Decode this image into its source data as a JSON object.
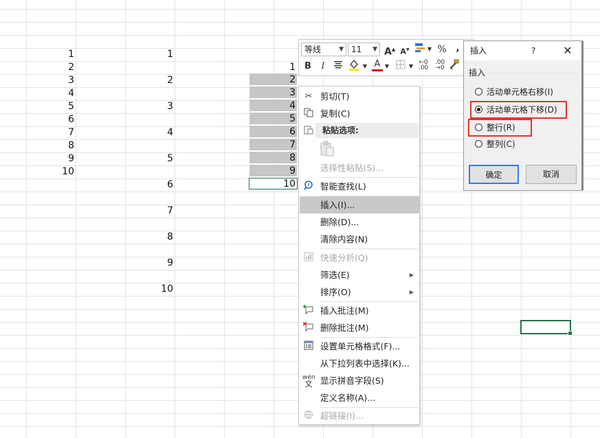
{
  "sheet": {
    "col_a_values": [
      "1",
      "2",
      "3",
      "4",
      "5",
      "6",
      "7",
      "8",
      "9",
      "10"
    ],
    "col_b_values": [
      "1",
      "2",
      "3",
      "4",
      "5",
      "6",
      "7",
      "8",
      "9",
      "10"
    ],
    "col_e_values": [
      "1",
      "2",
      "3",
      "4",
      "5",
      "6",
      "7",
      "8",
      "9",
      "10"
    ]
  },
  "mini_toolbar": {
    "font_name": "等线",
    "font_size": "11",
    "percent": "%",
    "comma": ",",
    "bold": "B",
    "italic": "I",
    "font_color_letter": "A",
    "grow_font": "A",
    "shrink_font": "A"
  },
  "context_menu": {
    "items": [
      {
        "label": "剪切(T)",
        "icon": "scissors-icon",
        "disabled": false
      },
      {
        "label": "复制(C)",
        "icon": "copy-icon",
        "disabled": false
      },
      {
        "label": "粘贴选项:",
        "icon": "paste-icon",
        "disabled": false
      },
      {
        "label": "选择性粘贴(S)...",
        "icon": "",
        "disabled": true
      },
      {
        "label": "智能查找(L)",
        "icon": "smart-lookup-icon",
        "disabled": false
      },
      {
        "label": "插入(I)...",
        "icon": "",
        "disabled": false,
        "highlighted": true
      },
      {
        "label": "删除(D)...",
        "icon": "",
        "disabled": false
      },
      {
        "label": "清除内容(N)",
        "icon": "",
        "disabled": false
      },
      {
        "label": "快速分析(Q)",
        "icon": "quick-analysis-icon",
        "disabled": true
      },
      {
        "label": "筛选(E)",
        "icon": "",
        "disabled": false,
        "submenu": true
      },
      {
        "label": "排序(O)",
        "icon": "",
        "disabled": false,
        "submenu": true
      },
      {
        "label": "插入批注(M)",
        "icon": "insert-comment-icon",
        "disabled": false
      },
      {
        "label": "删除批注(M)",
        "icon": "delete-comment-icon",
        "disabled": false
      },
      {
        "label": "设置单元格格式(F)...",
        "icon": "format-cells-icon",
        "disabled": false
      },
      {
        "label": "从下拉列表中选择(K)...",
        "icon": "",
        "disabled": false
      },
      {
        "label": "显示拼音字段(S)",
        "icon": "phonetic-icon",
        "disabled": false
      },
      {
        "label": "定义名称(A)...",
        "icon": "",
        "disabled": false
      },
      {
        "label": "超链接(I)...",
        "icon": "hyperlink-icon",
        "disabled": true
      }
    ]
  },
  "dialog": {
    "title": "插入",
    "help": "?",
    "close": "✕",
    "group_label": "插入",
    "options": [
      {
        "label": "活动单元格右移(I)",
        "selected": false
      },
      {
        "label": "活动单元格下移(D)",
        "selected": true
      },
      {
        "label": "整行(R)",
        "selected": false
      },
      {
        "label": "整列(C)",
        "selected": false
      }
    ],
    "ok_label": "确定",
    "cancel_label": "取消"
  },
  "colors": {
    "highlight_red": "#e0342f",
    "selection_gray": "#c6c6c6",
    "excel_green": "#217346",
    "primary_button_border": "#3b7bd4"
  }
}
